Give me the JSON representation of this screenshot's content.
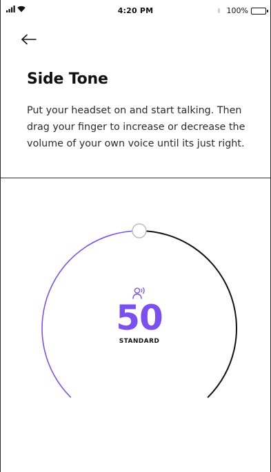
{
  "status_bar": {
    "time": "4:20 PM",
    "battery": "100%"
  },
  "page": {
    "title": "Side Tone",
    "description": "Put your headset on and start talking. Then drag your finger to increase or decrease the volume of your own voice until its just right."
  },
  "side_tone": {
    "value": "50",
    "mode": "STANDARD",
    "level_fraction": 0.5
  },
  "colors": {
    "accent": "#7b4ff0",
    "track": "#111111"
  },
  "icons": {
    "back": "arrow-left-icon",
    "voice": "speaking-person-icon",
    "signal": "cellular-signal-icon",
    "wifi": "wifi-icon",
    "battery": "battery-icon"
  }
}
